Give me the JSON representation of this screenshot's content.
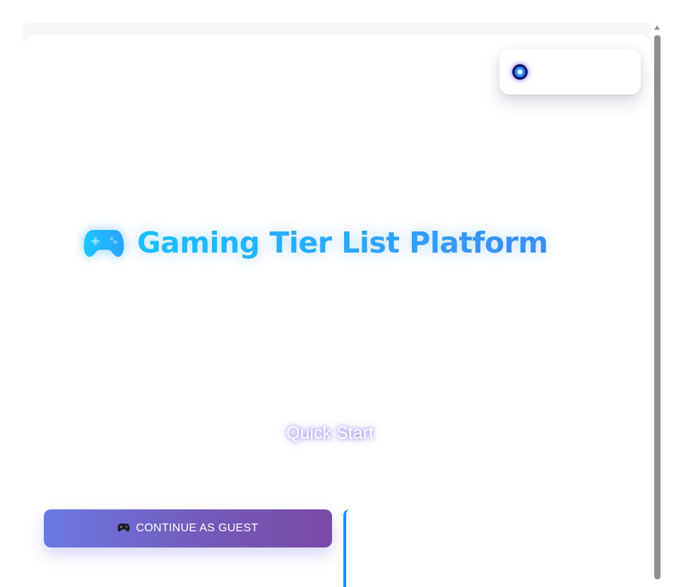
{
  "status_popup": {
    "text": "",
    "icon": "loading-spinner-icon"
  },
  "header": {
    "icon": "gamepad-icon",
    "title": "Gaming Tier List Platform"
  },
  "quick_start": {
    "heading": "Quick Start",
    "guest_button": {
      "icon": "gamepad-icon",
      "label": "CONTINUE AS GUEST"
    }
  },
  "colors": {
    "title_gradient_start": "#19c1ff",
    "title_gradient_end": "#3b8cf5",
    "button_gradient_start": "#6a79e2",
    "button_gradient_end": "#7a4aa8",
    "panel_accent": "#1e8cf0"
  }
}
